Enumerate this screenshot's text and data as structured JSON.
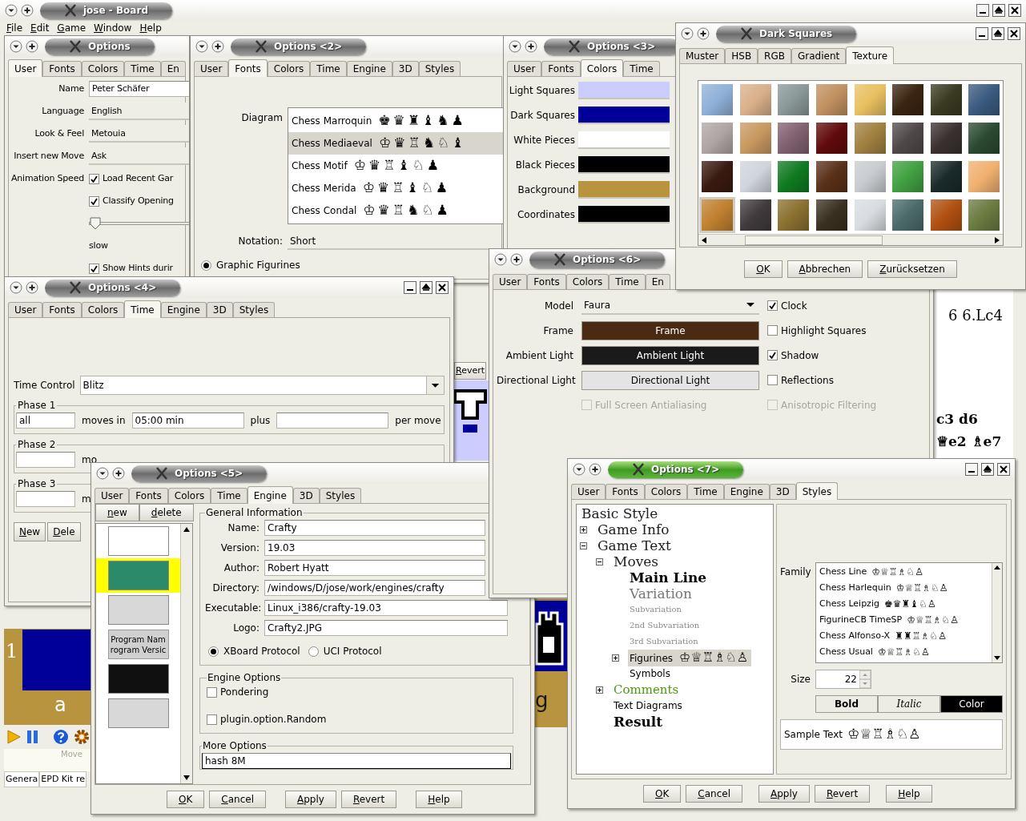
{
  "board_window": {
    "title": "jose - Board",
    "active": false,
    "menu": [
      "File",
      "Edit",
      "Game",
      "Window",
      "Help"
    ],
    "revert_button": "Revert",
    "rank_label": "1",
    "file_labels": [
      "a",
      "g"
    ],
    "notation": [
      "6 6.Lc4",
      "c3 d6",
      "♕e2 ♗e7"
    ],
    "move_label": "Move",
    "panel_tabs": [
      "Genera",
      "EPD Kit re"
    ]
  },
  "options_user": {
    "title": "Options",
    "active": false,
    "tabs": [
      {
        "label": "User",
        "selected": true
      },
      {
        "label": "Fonts",
        "selected": false
      },
      {
        "label": "Colors",
        "selected": false
      },
      {
        "label": "Time",
        "selected": false
      },
      {
        "label": "En",
        "selected": false
      }
    ],
    "rows": [
      {
        "kind": "field",
        "label": "Name",
        "value": "Peter Schäfer"
      },
      {
        "kind": "combo",
        "label": "Language",
        "value": "English"
      },
      {
        "kind": "combo",
        "label": "Look & Feel",
        "value": "Metouia"
      },
      {
        "kind": "combo",
        "label": "Insert new Move",
        "value": "Ask"
      },
      {
        "kind": "checkbox",
        "label": "Animation Speed",
        "text": "Load Recent Gar",
        "checked": true
      },
      {
        "kind": "checkbox",
        "text": "Classify Opening",
        "checked": true
      },
      {
        "kind": "slider",
        "level": 0
      },
      {
        "kind": "note",
        "text": "slow"
      },
      {
        "kind": "checkbox",
        "text": "Show Hints durir",
        "checked": true
      }
    ]
  },
  "options_fonts": {
    "title": "Options <2>",
    "active": false,
    "tabs": [
      {
        "label": "User",
        "selected": false
      },
      {
        "label": "Fonts",
        "selected": true
      },
      {
        "label": "Colors",
        "selected": false
      },
      {
        "label": "Time",
        "selected": false
      },
      {
        "label": "Engine",
        "selected": false
      },
      {
        "label": "3D",
        "selected": false
      },
      {
        "label": "Styles",
        "selected": false
      }
    ],
    "diagram_label": "Diagram",
    "diagram_fonts": [
      {
        "name": "Chess Marroquin",
        "sample": "♚♛♜♝♞♟",
        "selected": false
      },
      {
        "name": "Chess Mediaeval",
        "sample": "♔♛♖♞♘♝",
        "selected": true
      },
      {
        "name": "Chess Motif",
        "sample": "♔♛♖♝♘♟",
        "selected": false
      },
      {
        "name": "Chess Merida",
        "sample": "♔♛♖♝♘♟",
        "selected": false
      },
      {
        "name": "Chess Condal",
        "sample": "♔♛♖♞♘♟",
        "selected": false
      }
    ],
    "notation_label": "Notation:",
    "notation_value": "Short",
    "radio": {
      "label": "Graphic Figurines",
      "selected": true
    }
  },
  "options_colors": {
    "title": "Options <3>",
    "active": false,
    "tabs": [
      {
        "label": "User",
        "selected": false
      },
      {
        "label": "Fonts",
        "selected": false
      },
      {
        "label": "Colors",
        "selected": true
      },
      {
        "label": "Time",
        "selected": false
      }
    ],
    "colors": [
      {
        "label": "Light Squares",
        "color": "#ccccff"
      },
      {
        "label": "Dark Squares",
        "color": "#000099"
      },
      {
        "label": "White Pieces",
        "color": "#ffffff"
      },
      {
        "label": "Black Pieces",
        "color": "#000000"
      },
      {
        "label": "Background",
        "color": "#b8943e"
      },
      {
        "label": "Coordinates",
        "color": "#000000"
      }
    ]
  },
  "options_time": {
    "title": "Options <4>",
    "active": false,
    "tabs": [
      {
        "label": "User",
        "selected": false
      },
      {
        "label": "Fonts",
        "selected": false
      },
      {
        "label": "Colors",
        "selected": false
      },
      {
        "label": "Time",
        "selected": true
      },
      {
        "label": "Engine",
        "selected": false
      },
      {
        "label": "3D",
        "selected": false
      },
      {
        "label": "Styles",
        "selected": false
      }
    ],
    "time_control_label": "Time Control",
    "time_control_value": "Blitz",
    "phases": [
      {
        "title": "Phase 1",
        "moves": "all",
        "moves_label": "moves in",
        "time": "05:00 min",
        "plus_label": "plus",
        "per_move_label": "per move"
      },
      {
        "title": "Phase 2",
        "moves_label": "mo"
      },
      {
        "title": "Phase 3",
        "moves_label": "m"
      }
    ],
    "buttons": [
      "New",
      "Dele"
    ]
  },
  "options_engine": {
    "title": "Options <5>",
    "active": false,
    "tabs": [
      {
        "label": "User",
        "selected": false
      },
      {
        "label": "Fonts",
        "selected": false
      },
      {
        "label": "Colors",
        "selected": false
      },
      {
        "label": "Time",
        "selected": false
      },
      {
        "label": "Engine",
        "selected": true
      },
      {
        "label": "3D",
        "selected": false
      },
      {
        "label": "Styles",
        "selected": false
      }
    ],
    "list_buttons": [
      "new",
      "delete"
    ],
    "engines": [
      {
        "kind": "image",
        "color": "#ffffff",
        "selected": false
      },
      {
        "kind": "image",
        "color": "#2a8a6a",
        "selected": true
      },
      {
        "kind": "image",
        "color": "#d8d8d8",
        "selected": false
      },
      {
        "kind": "text",
        "lines": [
          "Program Nam",
          "rogram Versic"
        ],
        "selected": false
      },
      {
        "kind": "image",
        "color": "#101010",
        "selected": false
      },
      {
        "kind": "image",
        "color": "#d8d8d8",
        "selected": false
      }
    ],
    "general_title": "General Information",
    "fields": [
      {
        "label": "Name:",
        "value": "Crafty"
      },
      {
        "label": "Version:",
        "value": "19.03"
      },
      {
        "label": "Author:",
        "value": "Robert Hyatt"
      },
      {
        "label": "Directory:",
        "value": "/windows/D/jose/work/engines/crafty"
      },
      {
        "label": "Executable:",
        "value": "Linux_i386/crafty-19.03"
      },
      {
        "label": "Logo:",
        "value": "Crafty2.JPG"
      }
    ],
    "protocols": [
      {
        "label": "XBoard Protocol",
        "selected": true
      },
      {
        "label": "UCI Protocol",
        "selected": false
      }
    ],
    "engine_options_title": "Engine Options",
    "engine_options": [
      {
        "label": "Pondering",
        "checked": false
      },
      {
        "label": "plugin.option.Random",
        "checked": false
      }
    ],
    "more_options_title": "More Options",
    "more_options_value": "hash 8M",
    "buttons": [
      "OK",
      "Cancel",
      "Apply",
      "Revert",
      "Help"
    ]
  },
  "options_3d": {
    "title": "Options <6>",
    "active": false,
    "tabs": [
      {
        "label": "User",
        "selected": false
      },
      {
        "label": "Fonts",
        "selected": false
      },
      {
        "label": "Colors",
        "selected": false
      },
      {
        "label": "Time",
        "selected": false
      },
      {
        "label": "En",
        "selected": false
      }
    ],
    "rows": [
      {
        "label": "Model",
        "control": {
          "kind": "combo",
          "value": "Faura"
        },
        "option": {
          "label": "Clock",
          "checked": true
        }
      },
      {
        "label": "Frame",
        "control": {
          "kind": "button",
          "value": "Frame",
          "color": "#4a2a12"
        },
        "option": {
          "label": "Highlight Squares",
          "checked": false
        }
      },
      {
        "label": "Ambient Light",
        "control": {
          "kind": "button",
          "value": "Ambient Light",
          "color": "#1a1a1a"
        },
        "option": {
          "label": "Shadow",
          "checked": true
        }
      },
      {
        "label": "Directional Light",
        "control": {
          "kind": "button",
          "value": "Directional Light",
          "color": "#e4e4e4"
        },
        "option": {
          "label": "Reflections",
          "checked": false
        }
      }
    ],
    "disabled_options": [
      {
        "label": "Full Screen Antialiasing",
        "checked": false,
        "disabled": true
      },
      {
        "label": "Anisotropic Filtering",
        "checked": false,
        "disabled": true
      }
    ]
  },
  "dark_squares_dialog": {
    "title": "Dark Squares",
    "active": false,
    "tabs": [
      {
        "label": "Muster",
        "selected": false
      },
      {
        "label": "HSB",
        "selected": false
      },
      {
        "label": "RGB",
        "selected": false
      },
      {
        "label": "Gradient",
        "selected": false
      },
      {
        "label": "Texture",
        "selected": true
      }
    ],
    "textures": [
      {
        "color": "#8fb0d8",
        "selected": false
      },
      {
        "color": "#d9b08a",
        "selected": false
      },
      {
        "color": "#8a9898",
        "selected": false
      },
      {
        "color": "#c09060",
        "selected": false
      },
      {
        "color": "#e8c060",
        "selected": false
      },
      {
        "color": "#3a2410",
        "selected": false
      },
      {
        "color": "#3a3a20",
        "selected": false
      },
      {
        "color": "#3a5a80",
        "selected": false
      },
      {
        "color": "#b0a4a4",
        "selected": false
      },
      {
        "color": "#c89860",
        "selected": false
      },
      {
        "color": "#806070",
        "selected": false
      },
      {
        "color": "#600a0a",
        "selected": false
      },
      {
        "color": "#a08040",
        "selected": false
      },
      {
        "color": "#504848",
        "selected": false
      },
      {
        "color": "#3a3030",
        "selected": false
      },
      {
        "color": "#2a4a30",
        "selected": false
      },
      {
        "color": "#3a1a10",
        "selected": false
      },
      {
        "color": "#d0d4dc",
        "selected": false
      },
      {
        "color": "#107a20",
        "selected": false
      },
      {
        "color": "#5a3018",
        "selected": false
      },
      {
        "color": "#c8ccd0",
        "selected": false
      },
      {
        "color": "#40a040",
        "selected": false
      },
      {
        "color": "#1a2a2a",
        "selected": false
      },
      {
        "color": "#f0b070",
        "selected": false
      },
      {
        "color": "#c08030",
        "selected": true
      },
      {
        "color": "#403a3c",
        "selected": false
      },
      {
        "color": "#8a7030",
        "selected": false
      },
      {
        "color": "#3a3020",
        "selected": false
      },
      {
        "color": "#d8dce0",
        "selected": false
      },
      {
        "color": "#4a6a6a",
        "selected": false
      },
      {
        "color": "#b05010",
        "selected": false
      },
      {
        "color": "#6a7a40",
        "selected": false
      }
    ],
    "buttons": [
      "OK",
      "Abbrechen",
      "Zurücksetzen"
    ]
  },
  "options_styles": {
    "title": "Options <7>",
    "active": true,
    "tabs": [
      {
        "label": "User",
        "selected": false
      },
      {
        "label": "Fonts",
        "selected": false
      },
      {
        "label": "Colors",
        "selected": false
      },
      {
        "label": "Time",
        "selected": false
      },
      {
        "label": "Engine",
        "selected": false
      },
      {
        "label": "3D",
        "selected": false
      },
      {
        "label": "Styles",
        "selected": true
      }
    ],
    "tree": [
      {
        "label": "Basic Style",
        "kind": "title",
        "selected": false
      },
      {
        "label": "Game Info",
        "kind": "title",
        "expanded": false,
        "selected": false
      },
      {
        "label": "Game Text",
        "kind": "title",
        "expanded": true,
        "selected": false,
        "children": [
          {
            "label": "Moves",
            "kind": "title",
            "expanded": true,
            "selected": false,
            "children": [
              {
                "label": "Main Line",
                "kind": "main",
                "selected": false
              },
              {
                "label": "Variation",
                "kind": "variation",
                "selected": false
              },
              {
                "label": "Subvariation",
                "kind": "sub",
                "selected": false
              },
              {
                "label": "2nd Subvariation",
                "kind": "sub",
                "selected": false
              },
              {
                "label": "3rd Subvariation",
                "kind": "sub",
                "selected": false
              },
              {
                "label": "Figurines",
                "kind": "plain",
                "sample": "♔♕♖♗♘♙",
                "expanded": false,
                "selected": true
              },
              {
                "label": "Symbols",
                "kind": "plain",
                "selected": false
              }
            ]
          },
          {
            "label": "Comments",
            "kind": "comment",
            "expanded": false,
            "selected": false
          },
          {
            "label": "Text Diagrams",
            "kind": "plain",
            "selected": false
          },
          {
            "label": "Result",
            "kind": "main",
            "selected": false
          }
        ]
      }
    ],
    "family_label": "Family",
    "families": [
      {
        "name": "Chess Line",
        "sample": "♔♕♖♗♘♙"
      },
      {
        "name": "Chess Harlequin",
        "sample": "♔♕♖♗♘♙"
      },
      {
        "name": "Chess Leipzig",
        "sample": "♚♛♜♝♘♙"
      },
      {
        "name": "FigurineCB TimeSP",
        "sample": "♔♕♖♗♘♙"
      },
      {
        "name": "Chess Alfonso-X",
        "sample": "♜♜♖♗♘♙"
      },
      {
        "name": "Chess Usual",
        "sample": "♔♕♖♗♘♙"
      }
    ],
    "size_label": "Size",
    "size_value": "22",
    "style_buttons": [
      {
        "label": "Bold",
        "kind": "bold"
      },
      {
        "label": "Italic",
        "kind": "italic"
      },
      {
        "label": "Color",
        "kind": "color"
      }
    ],
    "sample_text": "Sample Text",
    "sample_glyphs": "♔♕♖♗♘♙",
    "buttons": [
      "OK",
      "Cancel",
      "Apply",
      "Revert",
      "Help"
    ]
  }
}
